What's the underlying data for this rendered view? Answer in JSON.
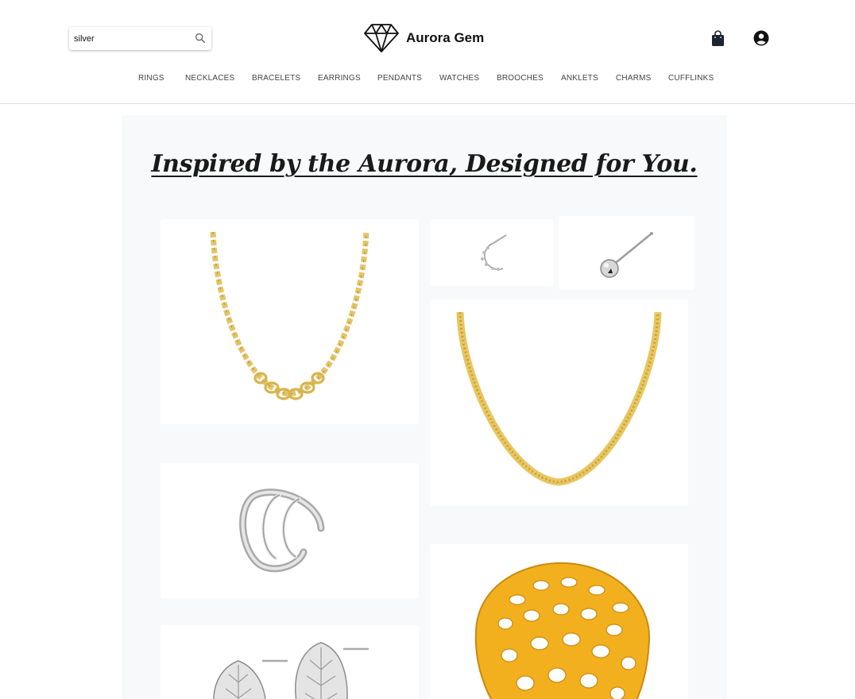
{
  "search": {
    "value": "silver",
    "icon": "search-icon"
  },
  "brand": {
    "name": "Aurora Gem",
    "logo": "diamond-logo"
  },
  "header_icons": {
    "bag": "shopping-bag-icon",
    "account": "account-circle-icon"
  },
  "nav": {
    "items": [
      "RINGS",
      "NECKLACES",
      "BRACELETS",
      "EARRINGS",
      "PENDANTS",
      "WATCHES",
      "BROOCHES",
      "ANKLETS",
      "CHARMS",
      "CUFFLINKS"
    ]
  },
  "hero": {
    "title": "Inspired by the Aurora, Designed for You."
  },
  "products": [
    {
      "name": "gold-curb-chain-necklace-image"
    },
    {
      "name": "moon-stud-earring-image"
    },
    {
      "name": "ball-stud-earring-image"
    },
    {
      "name": "gold-herringbone-chain-image"
    },
    {
      "name": "silver-ear-cuff-image"
    },
    {
      "name": "gold-filigree-ring-image"
    },
    {
      "name": "silver-leaf-stud-earrings-image"
    }
  ],
  "colors": {
    "gold": "#e8c660",
    "gold_dark": "#c9a13a",
    "ring_gold": "#f2b01e",
    "silver": "#c8c8c8",
    "silver_dark": "#8d8d8d",
    "panel": "#f8f9fa"
  }
}
